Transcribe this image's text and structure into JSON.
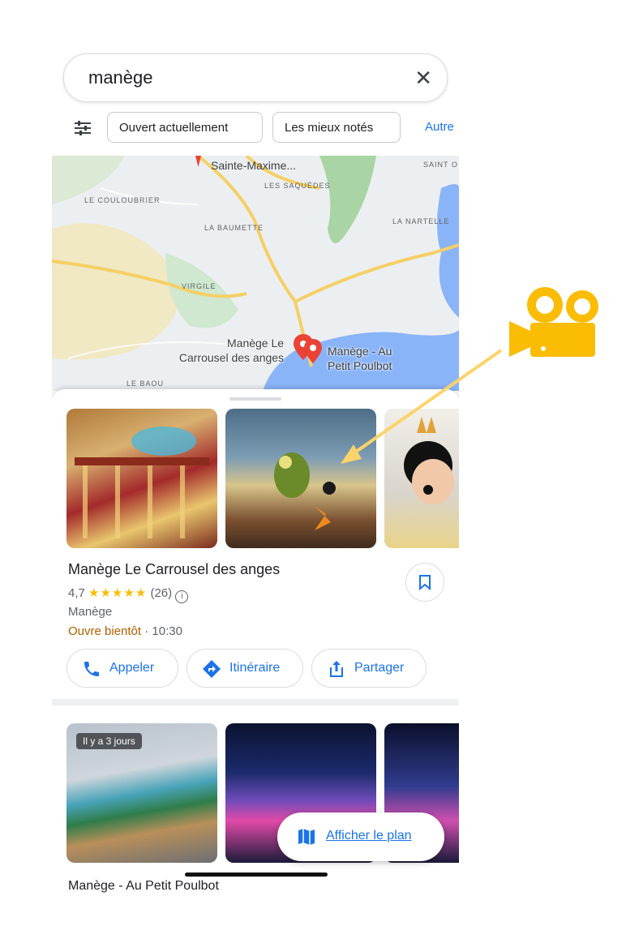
{
  "search": {
    "query": "manège",
    "clear_icon": "close-icon"
  },
  "chips": {
    "filter_icon": "tune-icon",
    "items": [
      "Ouvert actuellement",
      "Les mieux notés",
      "Autre"
    ]
  },
  "map": {
    "labels": [
      "Sainte-Maxime...",
      "SAINT O",
      "LES SAQUÈDES",
      "LE COULOUBRIER",
      "LA BAUMETTE",
      "LA NARTELLE",
      "VIRGILE",
      "LE BAOU"
    ],
    "pins": [
      "Manège Le Carrousel des anges",
      "Manège - Au Petit Poulbot"
    ],
    "pin_label_1_line1": "Manège Le",
    "pin_label_1_line2": "Carrousel des anges",
    "pin_label_2_line1": "Manège - Au",
    "pin_label_2_line2": "Petit Poulbot"
  },
  "place": {
    "title": "Manège Le Carrousel des anges",
    "rating": "4,7",
    "stars": "★★★★★",
    "reviews": "(26)",
    "category": "Manège",
    "status": "Ouvre bientôt",
    "time": " · 10:30",
    "actions": [
      "Appeler",
      "Itinéraire",
      "Partager"
    ]
  },
  "second": {
    "badge": "Il y a 3 jours",
    "title": "Manège - Au Petit Poulbot"
  },
  "show_map": "Afficher le plan",
  "colors": {
    "accent": "#1a73e8",
    "annotation": "#fbbc04",
    "road": "#f6cf65",
    "water": "#8ab4f8"
  }
}
